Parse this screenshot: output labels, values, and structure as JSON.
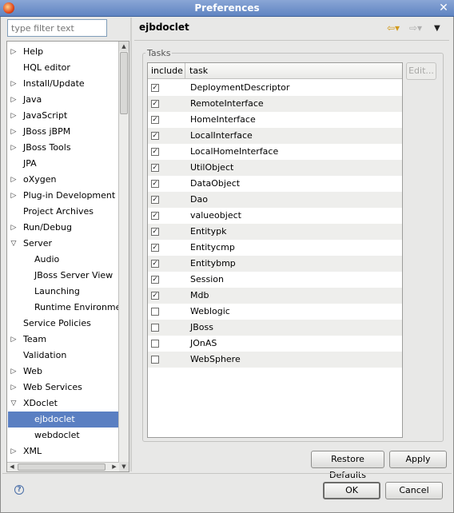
{
  "window": {
    "title": "Preferences"
  },
  "filter": {
    "placeholder": "type filter text"
  },
  "tree": [
    {
      "label": "Help",
      "arrow": "▷",
      "level": 0,
      "selected": false
    },
    {
      "label": "HQL editor",
      "arrow": "",
      "level": 0,
      "selected": false
    },
    {
      "label": "Install/Update",
      "arrow": "▷",
      "level": 0,
      "selected": false
    },
    {
      "label": "Java",
      "arrow": "▷",
      "level": 0,
      "selected": false
    },
    {
      "label": "JavaScript",
      "arrow": "▷",
      "level": 0,
      "selected": false
    },
    {
      "label": "JBoss jBPM",
      "arrow": "▷",
      "level": 0,
      "selected": false
    },
    {
      "label": "JBoss Tools",
      "arrow": "▷",
      "level": 0,
      "selected": false
    },
    {
      "label": "JPA",
      "arrow": "",
      "level": 0,
      "selected": false
    },
    {
      "label": "oXygen",
      "arrow": "▷",
      "level": 0,
      "selected": false
    },
    {
      "label": "Plug-in Development",
      "arrow": "▷",
      "level": 0,
      "selected": false
    },
    {
      "label": "Project Archives",
      "arrow": "",
      "level": 0,
      "selected": false
    },
    {
      "label": "Run/Debug",
      "arrow": "▷",
      "level": 0,
      "selected": false
    },
    {
      "label": "Server",
      "arrow": "▽",
      "level": 0,
      "selected": false
    },
    {
      "label": "Audio",
      "arrow": "",
      "level": 1,
      "selected": false
    },
    {
      "label": "JBoss Server View",
      "arrow": "",
      "level": 1,
      "selected": false
    },
    {
      "label": "Launching",
      "arrow": "",
      "level": 1,
      "selected": false
    },
    {
      "label": "Runtime Environmer",
      "arrow": "",
      "level": 1,
      "selected": false
    },
    {
      "label": "Service Policies",
      "arrow": "",
      "level": 0,
      "selected": false
    },
    {
      "label": "Team",
      "arrow": "▷",
      "level": 0,
      "selected": false
    },
    {
      "label": "Validation",
      "arrow": "",
      "level": 0,
      "selected": false
    },
    {
      "label": "Web",
      "arrow": "▷",
      "level": 0,
      "selected": false
    },
    {
      "label": "Web Services",
      "arrow": "▷",
      "level": 0,
      "selected": false
    },
    {
      "label": "XDoclet",
      "arrow": "▽",
      "level": 0,
      "selected": false
    },
    {
      "label": "ejbdoclet",
      "arrow": "",
      "level": 1,
      "selected": true
    },
    {
      "label": "webdoclet",
      "arrow": "",
      "level": 1,
      "selected": false
    },
    {
      "label": "XML",
      "arrow": "▷",
      "level": 0,
      "selected": false
    }
  ],
  "page": {
    "title": "ejbdoclet"
  },
  "nav": {
    "back": "⇦▾",
    "forward": "⇨▾",
    "menu": "▼"
  },
  "tasks": {
    "group_label": "Tasks",
    "columns": {
      "include": "include",
      "task": "task"
    },
    "rows": [
      {
        "name": "DeploymentDescriptor",
        "checked": true
      },
      {
        "name": "RemoteInterface",
        "checked": true
      },
      {
        "name": "HomeInterface",
        "checked": true
      },
      {
        "name": "LocalInterface",
        "checked": true
      },
      {
        "name": "LocalHomeInterface",
        "checked": true
      },
      {
        "name": "UtilObject",
        "checked": true
      },
      {
        "name": "DataObject",
        "checked": true
      },
      {
        "name": "Dao",
        "checked": true
      },
      {
        "name": "valueobject",
        "checked": true
      },
      {
        "name": "Entitypk",
        "checked": true
      },
      {
        "name": "Entitycmp",
        "checked": true
      },
      {
        "name": "Entitybmp",
        "checked": true
      },
      {
        "name": "Session",
        "checked": true
      },
      {
        "name": "Mdb",
        "checked": true
      },
      {
        "name": "Weblogic",
        "checked": false
      },
      {
        "name": "JBoss",
        "checked": false
      },
      {
        "name": "JOnAS",
        "checked": false
      },
      {
        "name": "WebSphere",
        "checked": false
      }
    ],
    "edit_label": "Edit..."
  },
  "buttons": {
    "restore_defaults": "Restore Defaults",
    "apply": "Apply",
    "ok": "OK",
    "cancel": "Cancel"
  },
  "help": {
    "glyph": "?"
  },
  "colors": {
    "selection": "#5a7fc2",
    "titlebar": "#6f8fc9"
  }
}
